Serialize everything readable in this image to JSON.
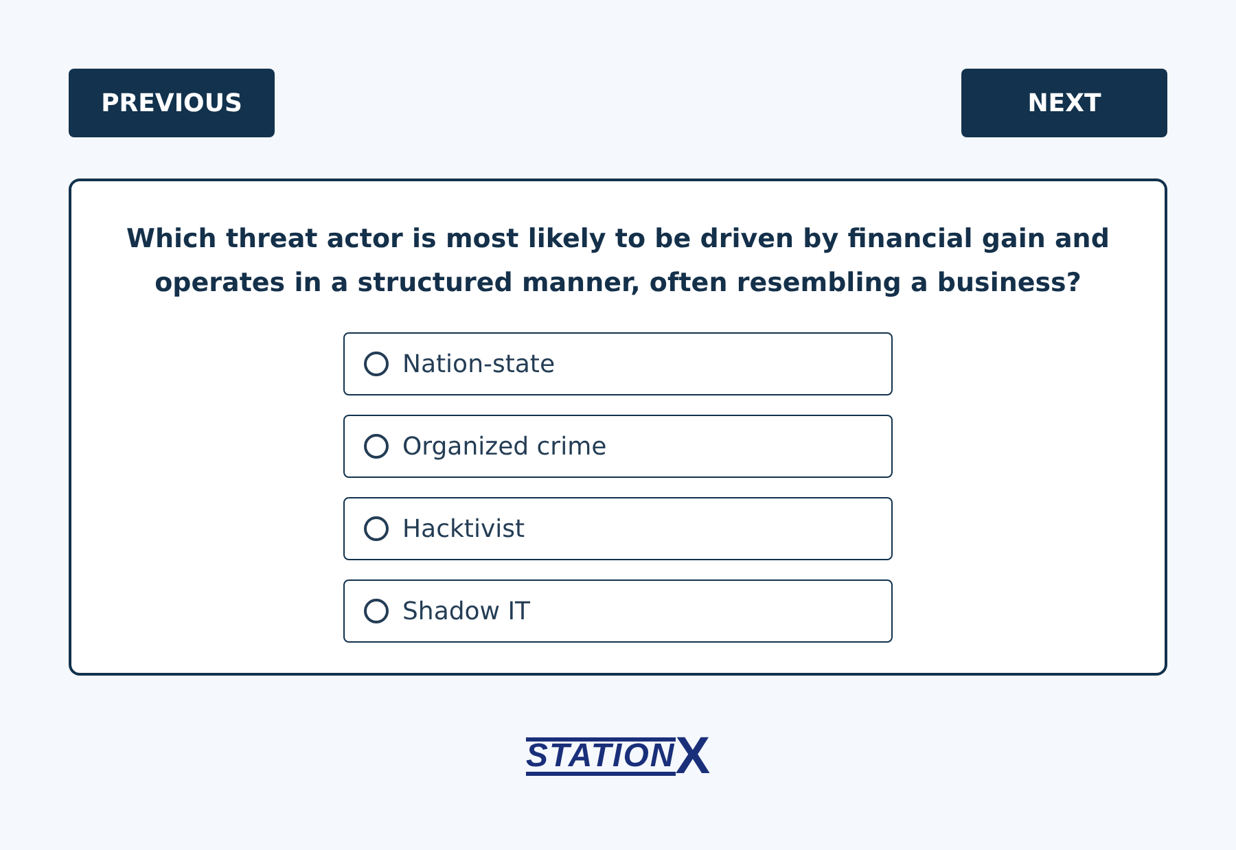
{
  "nav": {
    "previous": "PREVIOUS",
    "next": "NEXT"
  },
  "question": "Which threat actor is most likely to be driven by financial gain and operates in a structured manner, often resembling a business?",
  "options": [
    {
      "label": "Nation-state",
      "selected": false
    },
    {
      "label": "Organized crime",
      "selected": false
    },
    {
      "label": "Hacktivist",
      "selected": false
    },
    {
      "label": "Shadow IT",
      "selected": false
    }
  ],
  "logo": {
    "text": "STATION",
    "mark": "X"
  }
}
